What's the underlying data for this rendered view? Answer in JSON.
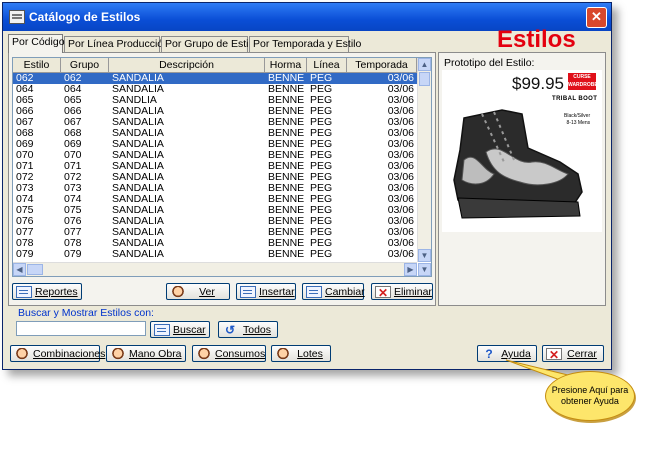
{
  "window": {
    "title": "Catálogo de Estilos",
    "close_glyph": "✕"
  },
  "brand": "Estilos",
  "tabs": [
    {
      "label": "Por Código",
      "active": true
    },
    {
      "label": "Por Línea Producción",
      "active": false
    },
    {
      "label": "Por Grupo de Estilo",
      "active": false
    },
    {
      "label": "Por Temporada y Estilo",
      "active": false
    }
  ],
  "grid": {
    "columns": [
      "Estilo",
      "Grupo",
      "Descripción",
      "Horma",
      "Línea",
      "Temporada"
    ],
    "rows": [
      [
        "062",
        "062",
        "SANDALIA",
        "BENNE",
        "PEG",
        "03/06"
      ],
      [
        "064",
        "064",
        "SANDALIA",
        "BENNE",
        "PEG",
        "03/06"
      ],
      [
        "065",
        "065",
        "SANDLIA",
        "BENNE",
        "PEG",
        "03/06"
      ],
      [
        "066",
        "066",
        "SANDALIA",
        "BENNE",
        "PEG",
        "03/06"
      ],
      [
        "067",
        "067",
        "SANDALIA",
        "BENNE",
        "PEG",
        "03/06"
      ],
      [
        "068",
        "068",
        "SANDALIA",
        "BENNE",
        "PEG",
        "03/06"
      ],
      [
        "069",
        "069",
        "SANDALIA",
        "BENNE",
        "PEG",
        "03/06"
      ],
      [
        "070",
        "070",
        "SANDALIA",
        "BENNE",
        "PEG",
        "03/06"
      ],
      [
        "071",
        "071",
        "SANDALIA",
        "BENNE",
        "PEG",
        "03/06"
      ],
      [
        "072",
        "072",
        "SANDALIA",
        "BENNE",
        "PEG",
        "03/06"
      ],
      [
        "073",
        "073",
        "SANDALIA",
        "BENNE",
        "PEG",
        "03/06"
      ],
      [
        "074",
        "074",
        "SANDALIA",
        "BENNE",
        "PEG",
        "03/06"
      ],
      [
        "075",
        "075",
        "SANDALIA",
        "BENNE",
        "PEG",
        "03/06"
      ],
      [
        "076",
        "076",
        "SANDALIA",
        "BENNE",
        "PEG",
        "03/06"
      ],
      [
        "077",
        "077",
        "SANDALIA",
        "BENNE",
        "PEG",
        "03/06"
      ],
      [
        "078",
        "078",
        "SANDALIA",
        "BENNE",
        "PEG",
        "03/06"
      ],
      [
        "079",
        "079",
        "SANDALIA",
        "BENNE",
        "PEG",
        "03/06"
      ]
    ],
    "selected_row": 0
  },
  "buttons": {
    "reportes": "Reportes",
    "ver": "Ver",
    "insertar": "Insertar",
    "cambiar": "Cambiar",
    "eliminar": "Eliminar",
    "buscar": "Buscar",
    "todos": "Todos",
    "combinaciones": "Combinaciones",
    "mano_obra": "Mano Obra",
    "consumos": "Consumos",
    "lotes": "Lotes",
    "ayuda": "Ayuda",
    "cerrar": "Cerrar"
  },
  "search": {
    "label": "Buscar y Mostrar Estilos con:",
    "value": ""
  },
  "prototype": {
    "label": "Prototipo del Estilo:",
    "price": "$99.95",
    "badge": "CURSE WARDROBE",
    "name": "TRIBAL BOOT",
    "size_line1": "Black/Silver",
    "size_line2": "8-13 Mens"
  },
  "callout": "Presione Aquí para obtener Ayuda",
  "colors": {
    "title_bar": "#0a4ed6",
    "selection": "#316ac5",
    "brand_red": "#e4000f",
    "callout_fill": "#fde66b"
  }
}
